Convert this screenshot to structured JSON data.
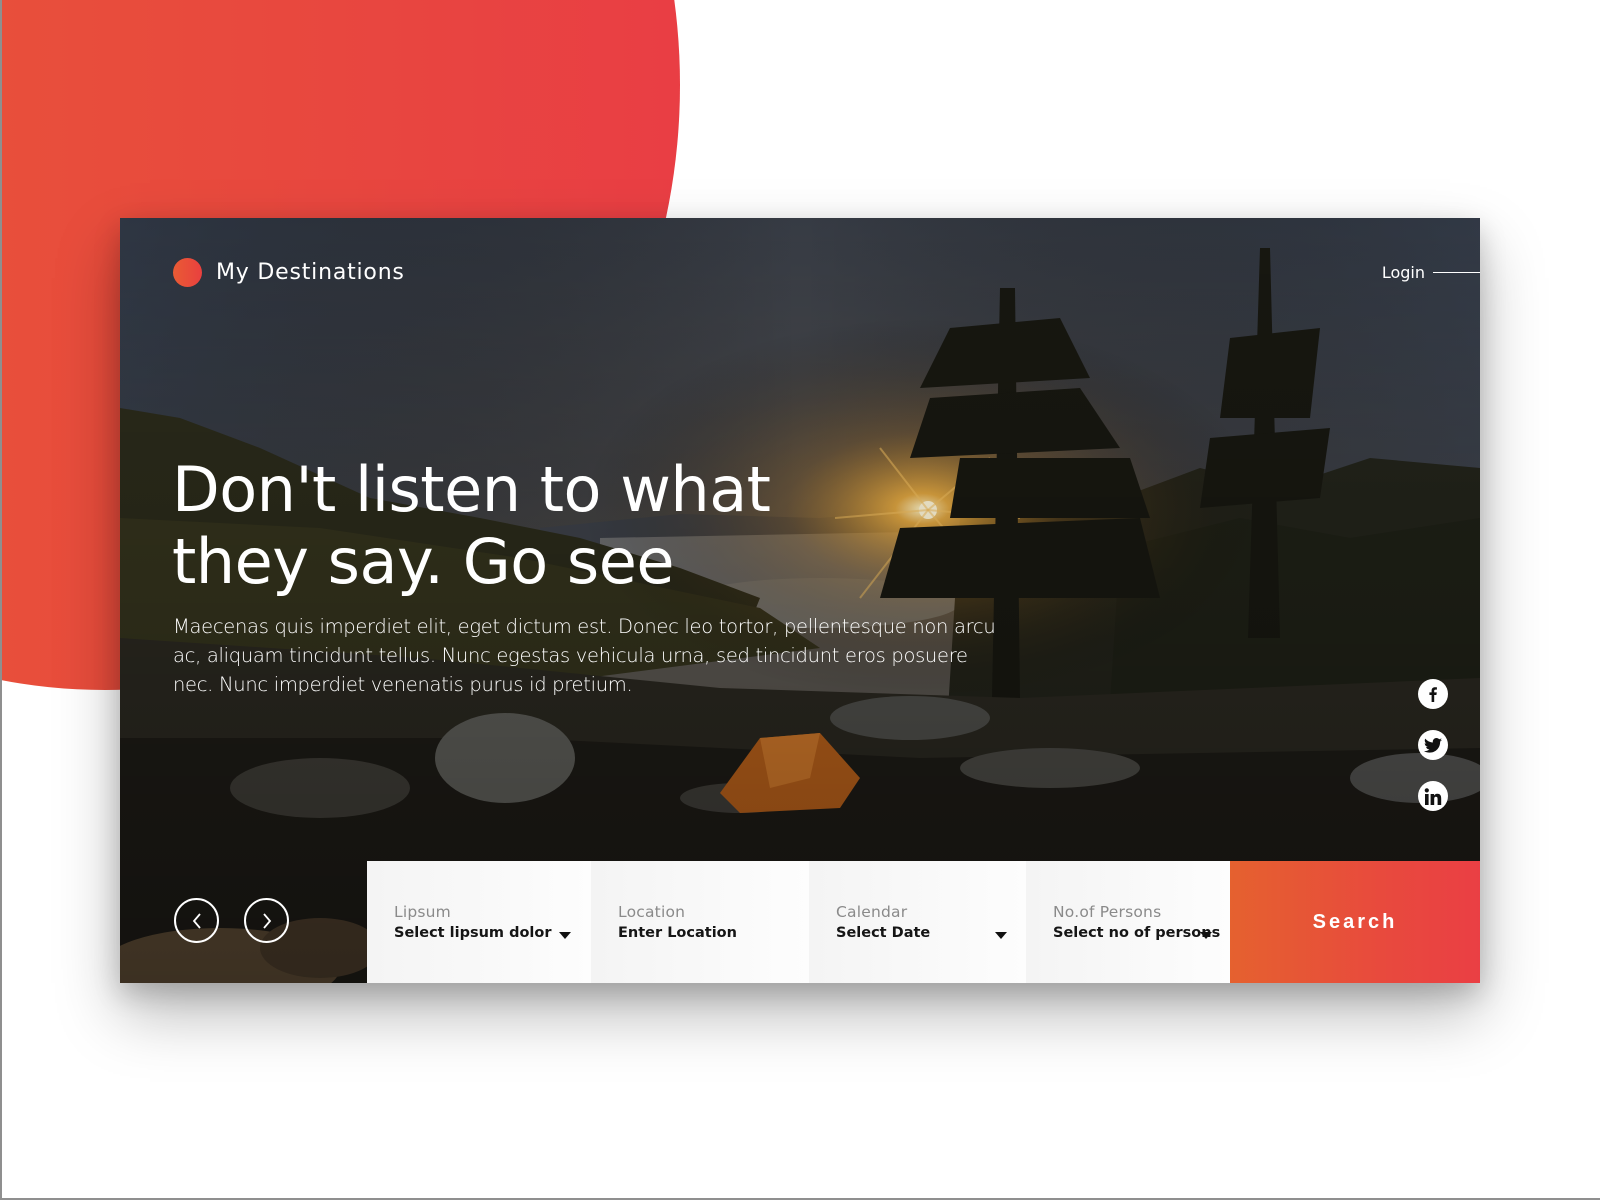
{
  "brand": {
    "name": "My Destinations",
    "accent_start": "#e95b34",
    "accent_end": "#e9403f"
  },
  "header": {
    "login_label": "Login"
  },
  "hero": {
    "headline_line1": "Don't listen to what",
    "headline_line2": "they say. Go see",
    "body": "Maecenas quis imperdiet elit, eget dictum est. Donec leo tortor, pellentesque non arcu ac, aliquam tincidunt tellus. Nunc egestas vehicula urna, sed tincidunt eros posuere nec. Nunc imperdiet venenatis purus id pretium.",
    "background_scene": "sunset forest lake campsite with orange tent"
  },
  "social": [
    {
      "name": "facebook",
      "icon": "facebook-icon"
    },
    {
      "name": "twitter",
      "icon": "twitter-icon"
    },
    {
      "name": "linkedin",
      "icon": "linkedin-icon"
    }
  ],
  "carousel": {
    "prev_icon": "chevron-left-icon",
    "next_icon": "chevron-right-icon"
  },
  "search": {
    "fields": [
      {
        "label": "Lipsum",
        "value": "Select lipsum dolor",
        "has_dropdown": true
      },
      {
        "label": "Location",
        "value": "Enter Location",
        "has_dropdown": false
      },
      {
        "label": "Calendar",
        "value": "Select Date",
        "has_dropdown": true
      },
      {
        "label": "No.of Persons",
        "value": "Select no of persons",
        "has_dropdown": true
      }
    ],
    "button_label": "Search"
  }
}
